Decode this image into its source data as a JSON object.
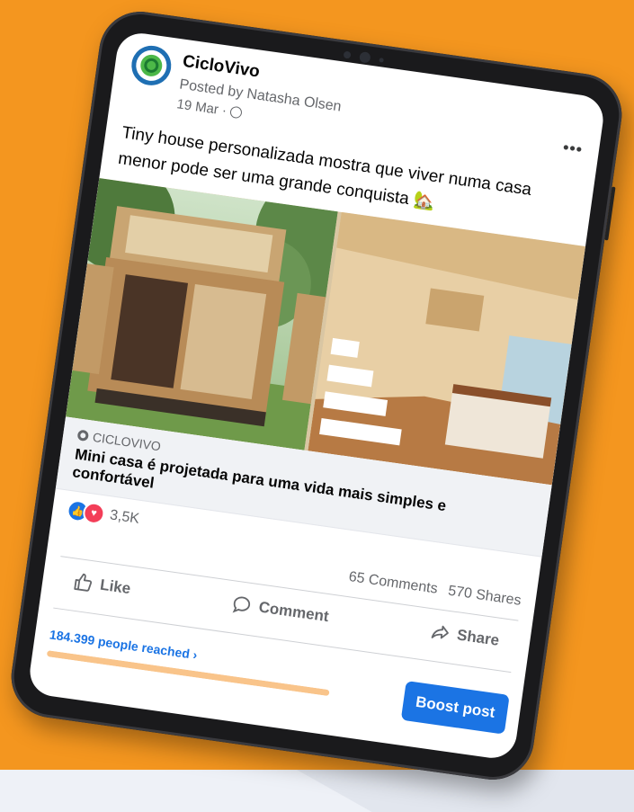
{
  "colors": {
    "background": "#f4961f",
    "facebook_blue": "#1b74e4",
    "like_blue": "#1b74e4",
    "love_red": "#f33e58",
    "reach_bar": "#f9c48a"
  },
  "post": {
    "page_name": "CicloVivo",
    "posted_by": "Posted by Natasha Olsen",
    "date": "19 Mar ·",
    "privacy_icon": "globe-icon",
    "more_icon": "more-options-icon",
    "more_label": "•••",
    "caption": "Tiny house personalizada mostra que viver numa casa menor pode ser uma grande conquista 🏡"
  },
  "link_preview": {
    "domain": "CICLOVIVO",
    "title": "Mini casa é projetada para uma vida mais simples e confortável"
  },
  "stats": {
    "reaction_icons": [
      "like-reaction-icon",
      "love-reaction-icon"
    ],
    "reactions": "3,5K",
    "comments": "65 Comments",
    "shares": "570 Shares"
  },
  "actions": {
    "like": "Like",
    "comment": "Comment",
    "share": "Share"
  },
  "footer": {
    "reach": "184.399 people reached ›",
    "reach_progress": 0.88,
    "boost": "Boost post"
  }
}
